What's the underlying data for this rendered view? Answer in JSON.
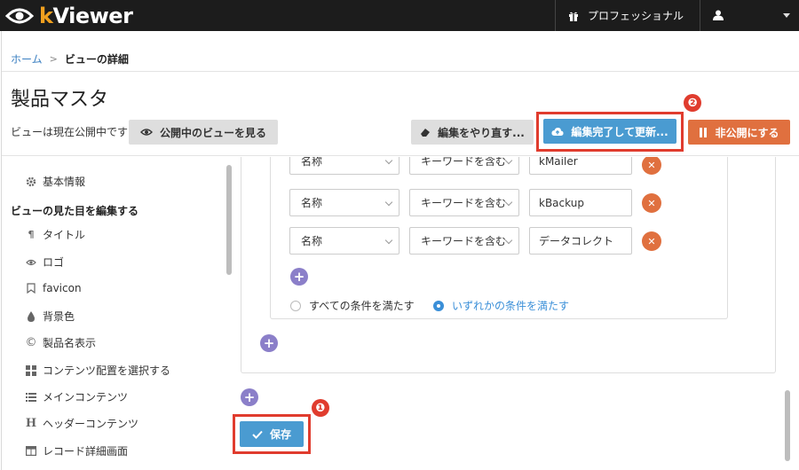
{
  "app": {
    "logo_text_k": "k",
    "logo_text_rest": "Viewer",
    "plan_label": "プロフェッショナル"
  },
  "breadcrumb": {
    "home": "ホーム",
    "current": "ビューの詳細"
  },
  "page": {
    "title": "製品マスタ",
    "publish_status": "ビューは現在公開中です",
    "view_public_button": "公開中のビューを見る",
    "redo_button": "編集をやり直す...",
    "finish_update_button": "編集完了して更新...",
    "unpublish_button": "非公開にする",
    "save_button": "保存"
  },
  "annotations": {
    "badge_1": "❶",
    "badge_2": "❷"
  },
  "sidebar": {
    "basic_info": "基本情報",
    "section_heading": "ビューの見た目を編集する",
    "items": [
      {
        "label": "タイトル",
        "icon": "pilcrow-icon"
      },
      {
        "label": "ロゴ",
        "icon": "eye-icon"
      },
      {
        "label": "favicon",
        "icon": "bookmark-icon"
      },
      {
        "label": "背景色",
        "icon": "droplet-icon"
      },
      {
        "label": "製品名表示",
        "icon": "copyright-icon"
      },
      {
        "label": "コンテンツ配置を選択する",
        "icon": "grid-icon"
      },
      {
        "label": "メインコンテンツ",
        "icon": "list-icon"
      },
      {
        "label": "ヘッダーコンテンツ",
        "icon": "header-icon"
      },
      {
        "label": "レコード詳細画面",
        "icon": "table-icon"
      }
    ]
  },
  "filters": {
    "rows": [
      {
        "field": "名称",
        "operator": "キーワードを含む",
        "value": "kMailer"
      },
      {
        "field": "名称",
        "operator": "キーワードを含む",
        "value": "kBackup"
      },
      {
        "field": "名称",
        "operator": "キーワードを含む",
        "value": "データコレクト"
      }
    ],
    "match_all": "すべての条件を満たす",
    "match_any": "いずれかの条件を満たす",
    "selected": "match_any"
  },
  "colors": {
    "accent_blue": "#4a9bd1",
    "accent_orange": "#e0703f",
    "highlight_red": "#e03c2e",
    "add_purple": "#8b7fc9"
  }
}
